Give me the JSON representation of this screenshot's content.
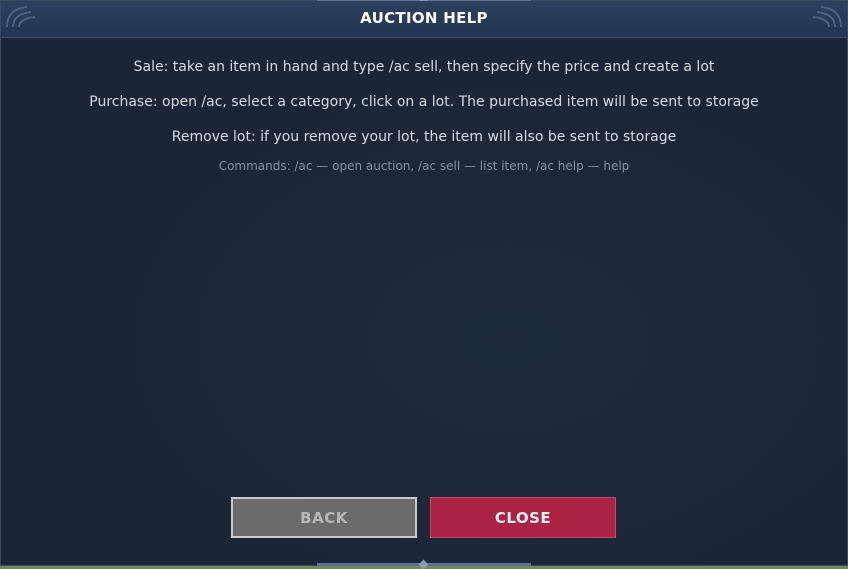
{
  "window": {
    "title": "AUCTION HELP"
  },
  "help": {
    "sale": "Sale: take an item in hand and type /ac sell, then specify the price and create a lot",
    "purchase": "Purchase: open /ac, select a category, click on a lot. The purchased item will be sent to storage",
    "remove": "Remove lot: if you remove your lot, the item will also be sent to storage",
    "commands": "Commands: /ac — open auction, /ac sell — list item, /ac help — help"
  },
  "buttons": {
    "back_label": "BACK",
    "close_label": "CLOSE"
  },
  "colors": {
    "panel_bg": "#1a2535",
    "titlebar_bg": "#223552",
    "back_button": "#6b6b6b",
    "close_button": "#ab2344"
  }
}
